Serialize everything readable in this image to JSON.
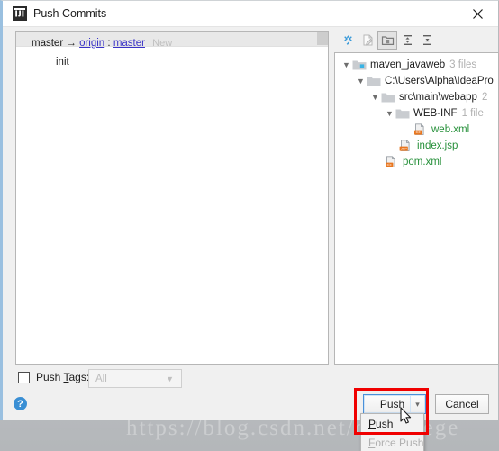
{
  "window": {
    "title": "Push Commits",
    "app_icon": "intellij-idea-icon",
    "close_label": "✕"
  },
  "commits": {
    "repo_local": "master",
    "arrow": "→",
    "remote": "origin",
    "separator": ":",
    "remote_branch": "master",
    "new_badge": "New",
    "entries": [
      {
        "message": "init"
      }
    ]
  },
  "tree_toolbar": {
    "buttons": [
      {
        "name": "show-diff-icon",
        "title": "Show Diff",
        "pressed": false
      },
      {
        "name": "edit-source-icon",
        "title": "Edit Source",
        "pressed": false
      },
      {
        "name": "group-by-directory-icon",
        "title": "Group by Directory",
        "pressed": true
      },
      {
        "name": "expand-all-icon",
        "title": "Expand All",
        "pressed": false
      },
      {
        "name": "collapse-all-icon",
        "title": "Collapse All",
        "pressed": false
      }
    ]
  },
  "file_tree": [
    {
      "label": "maven_javaweb",
      "count": "3 files",
      "icon": "module-folder-icon",
      "indent": 0,
      "expanded": true,
      "green": false
    },
    {
      "label": "C:\\Users\\Alpha\\IdeaPro",
      "count": "",
      "icon": "folder-icon",
      "indent": 1,
      "expanded": true,
      "green": false
    },
    {
      "label": "src\\main\\webapp",
      "count": "2",
      "icon": "folder-icon",
      "indent": 2,
      "expanded": true,
      "green": false
    },
    {
      "label": "WEB-INF",
      "count": "1 file",
      "icon": "folder-icon",
      "indent": 3,
      "expanded": true,
      "green": false
    },
    {
      "label": "web.xml",
      "count": "",
      "icon": "xml-file-icon",
      "indent": 4,
      "expanded": null,
      "green": true
    },
    {
      "label": "index.jsp",
      "count": "",
      "icon": "jsp-file-icon",
      "indent": 3,
      "expanded": null,
      "green": true
    },
    {
      "label": "pom.xml",
      "count": "",
      "icon": "xml-file-icon",
      "indent": 2,
      "expanded": null,
      "green": true
    }
  ],
  "push_tags": {
    "label_pre": "Push ",
    "label_mnemonic": "T",
    "label_post": "ags:",
    "checked": false,
    "combo_value": "All",
    "combo_enabled": false
  },
  "help": {
    "glyph": "?"
  },
  "buttons": {
    "push": "Push",
    "push_arrow": "▾",
    "cancel": "Cancel"
  },
  "dropdown_menu": {
    "open": true,
    "items": [
      {
        "mnemonic": "P",
        "rest": "ush",
        "enabled": true
      },
      {
        "mnemonic": "F",
        "rest": "orce Push",
        "enabled": false
      }
    ]
  },
  "watermark": {
    "text": "https://blog.csdn.net/qini_gege"
  },
  "colors": {
    "link": "#3a33c8",
    "new_file_green": "#26903a",
    "focus_blue": "#4a90d9",
    "annotation_red": "#f00000",
    "help_blue": "#3a8fd4",
    "muted_gray": "#b0b0b0"
  }
}
